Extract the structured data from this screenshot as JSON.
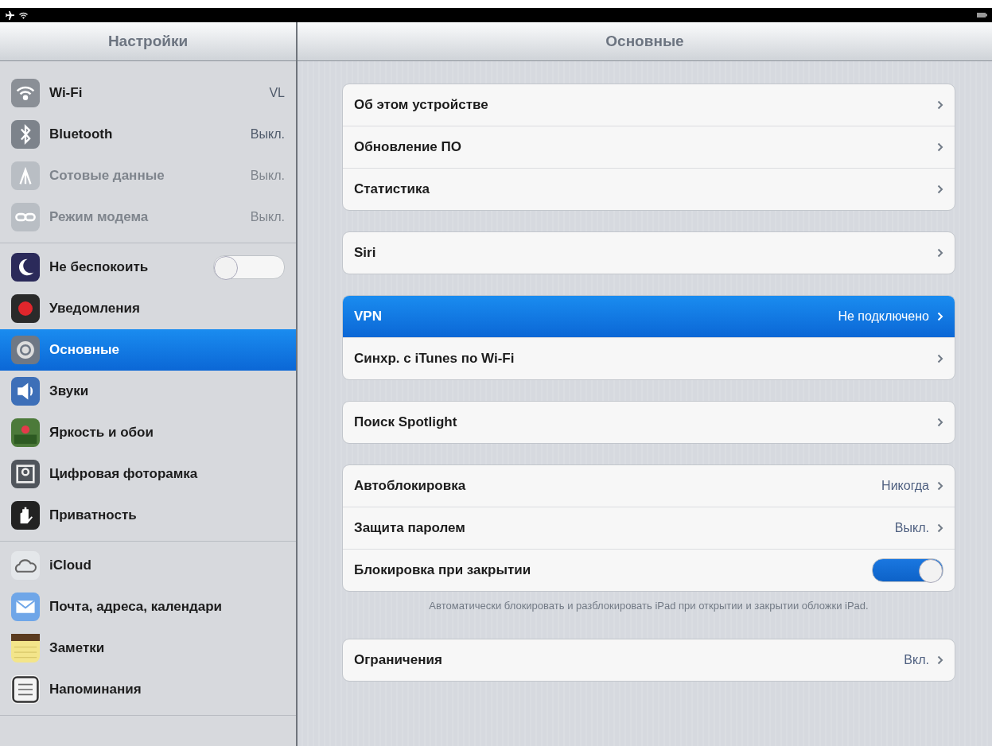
{
  "nav": {
    "left_title": "Настройки",
    "right_title": "Основные"
  },
  "sidebar": {
    "groups": [
      [
        {
          "label": "Wi-Fi",
          "value": "VL",
          "disabled": false,
          "selected": false,
          "kind": "link"
        },
        {
          "label": "Bluetooth",
          "value": "Выкл.",
          "disabled": false,
          "selected": false,
          "kind": "link"
        },
        {
          "label": "Сотовые данные",
          "value": "Выкл.",
          "disabled": true,
          "selected": false,
          "kind": "link"
        },
        {
          "label": "Режим модема",
          "value": "Выкл.",
          "disabled": true,
          "selected": false,
          "kind": "link"
        }
      ],
      [
        {
          "label": "Не беспокоить",
          "disabled": false,
          "selected": false,
          "kind": "toggle",
          "on": false
        },
        {
          "label": "Уведомления",
          "disabled": false,
          "selected": false,
          "kind": "link"
        },
        {
          "label": "Основные",
          "disabled": false,
          "selected": true,
          "kind": "link"
        },
        {
          "label": "Звуки",
          "disabled": false,
          "selected": false,
          "kind": "link"
        },
        {
          "label": "Яркость и обои",
          "disabled": false,
          "selected": false,
          "kind": "link"
        },
        {
          "label": "Цифровая фоторамка",
          "disabled": false,
          "selected": false,
          "kind": "link"
        },
        {
          "label": "Приватность",
          "disabled": false,
          "selected": false,
          "kind": "link"
        }
      ],
      [
        {
          "label": "iCloud",
          "disabled": false,
          "selected": false,
          "kind": "link"
        },
        {
          "label": "Почта, адреса, календари",
          "disabled": false,
          "selected": false,
          "kind": "link"
        },
        {
          "label": "Заметки",
          "disabled": false,
          "selected": false,
          "kind": "link"
        },
        {
          "label": "Напоминания",
          "disabled": false,
          "selected": false,
          "kind": "link"
        }
      ]
    ]
  },
  "content": {
    "groups": [
      {
        "rows": [
          {
            "label": "Об этом устройстве",
            "kind": "link",
            "selected": false
          },
          {
            "label": "Обновление ПО",
            "kind": "link",
            "selected": false
          },
          {
            "label": "Статистика",
            "kind": "link",
            "selected": false
          }
        ]
      },
      {
        "rows": [
          {
            "label": "Siri",
            "kind": "link",
            "selected": false
          }
        ]
      },
      {
        "rows": [
          {
            "label": "VPN",
            "value": "Не подключено",
            "kind": "link",
            "selected": true
          },
          {
            "label": "Синхр. с iTunes по Wi-Fi",
            "kind": "link",
            "selected": false
          }
        ]
      },
      {
        "rows": [
          {
            "label": "Поиск Spotlight",
            "kind": "link",
            "selected": false
          }
        ]
      },
      {
        "rows": [
          {
            "label": "Автоблокировка",
            "value": "Никогда",
            "kind": "link",
            "selected": false
          },
          {
            "label": "Защита паролем",
            "value": "Выкл.",
            "kind": "link",
            "selected": false
          },
          {
            "label": "Блокировка при закрытии",
            "kind": "toggle",
            "on": true,
            "selected": false
          }
        ],
        "footer": "Автоматически блокировать и разблокировать iPad при открытии и закрытии обложки iPad."
      },
      {
        "rows": [
          {
            "label": "Ограничения",
            "value": "Вкл.",
            "kind": "link",
            "selected": false
          }
        ]
      }
    ]
  }
}
